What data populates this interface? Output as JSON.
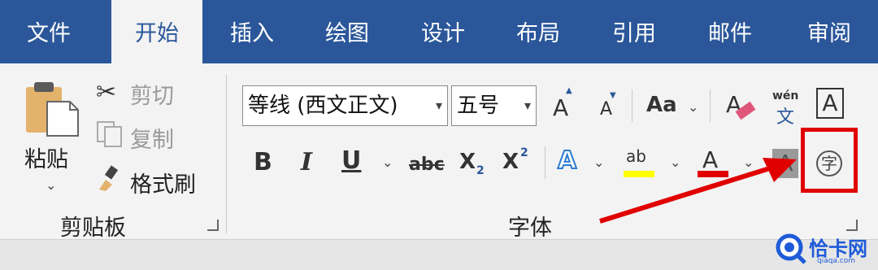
{
  "tabs": [
    "文件",
    "开始",
    "插入",
    "绘图",
    "设计",
    "布局",
    "引用",
    "邮件",
    "审阅"
  ],
  "clipboard": {
    "paste_label": "粘贴",
    "cut_label": "剪切",
    "copy_label": "复制",
    "format_painter_label": "格式刷",
    "group_label": "剪贴板"
  },
  "font": {
    "font_name": "等线 (西文正文)",
    "font_size": "五号",
    "case_label": "Aa",
    "bold": "B",
    "italic": "I",
    "underline": "U",
    "strike": "abc",
    "sub": "X",
    "sub_small": "2",
    "sup": "X",
    "sup_small": "2",
    "pinyin_top": "wén",
    "pinyin_bottom": "文",
    "border_letter": "A",
    "enclose_char": "字",
    "group_label": "字体"
  },
  "watermark": {
    "text": "恰卡网",
    "url": "qiaqa.com"
  },
  "colors": {
    "tab_bar": "#2b579a",
    "highlight": "#ffff00",
    "font_color": "#e00000",
    "annotation": "#e00000"
  }
}
